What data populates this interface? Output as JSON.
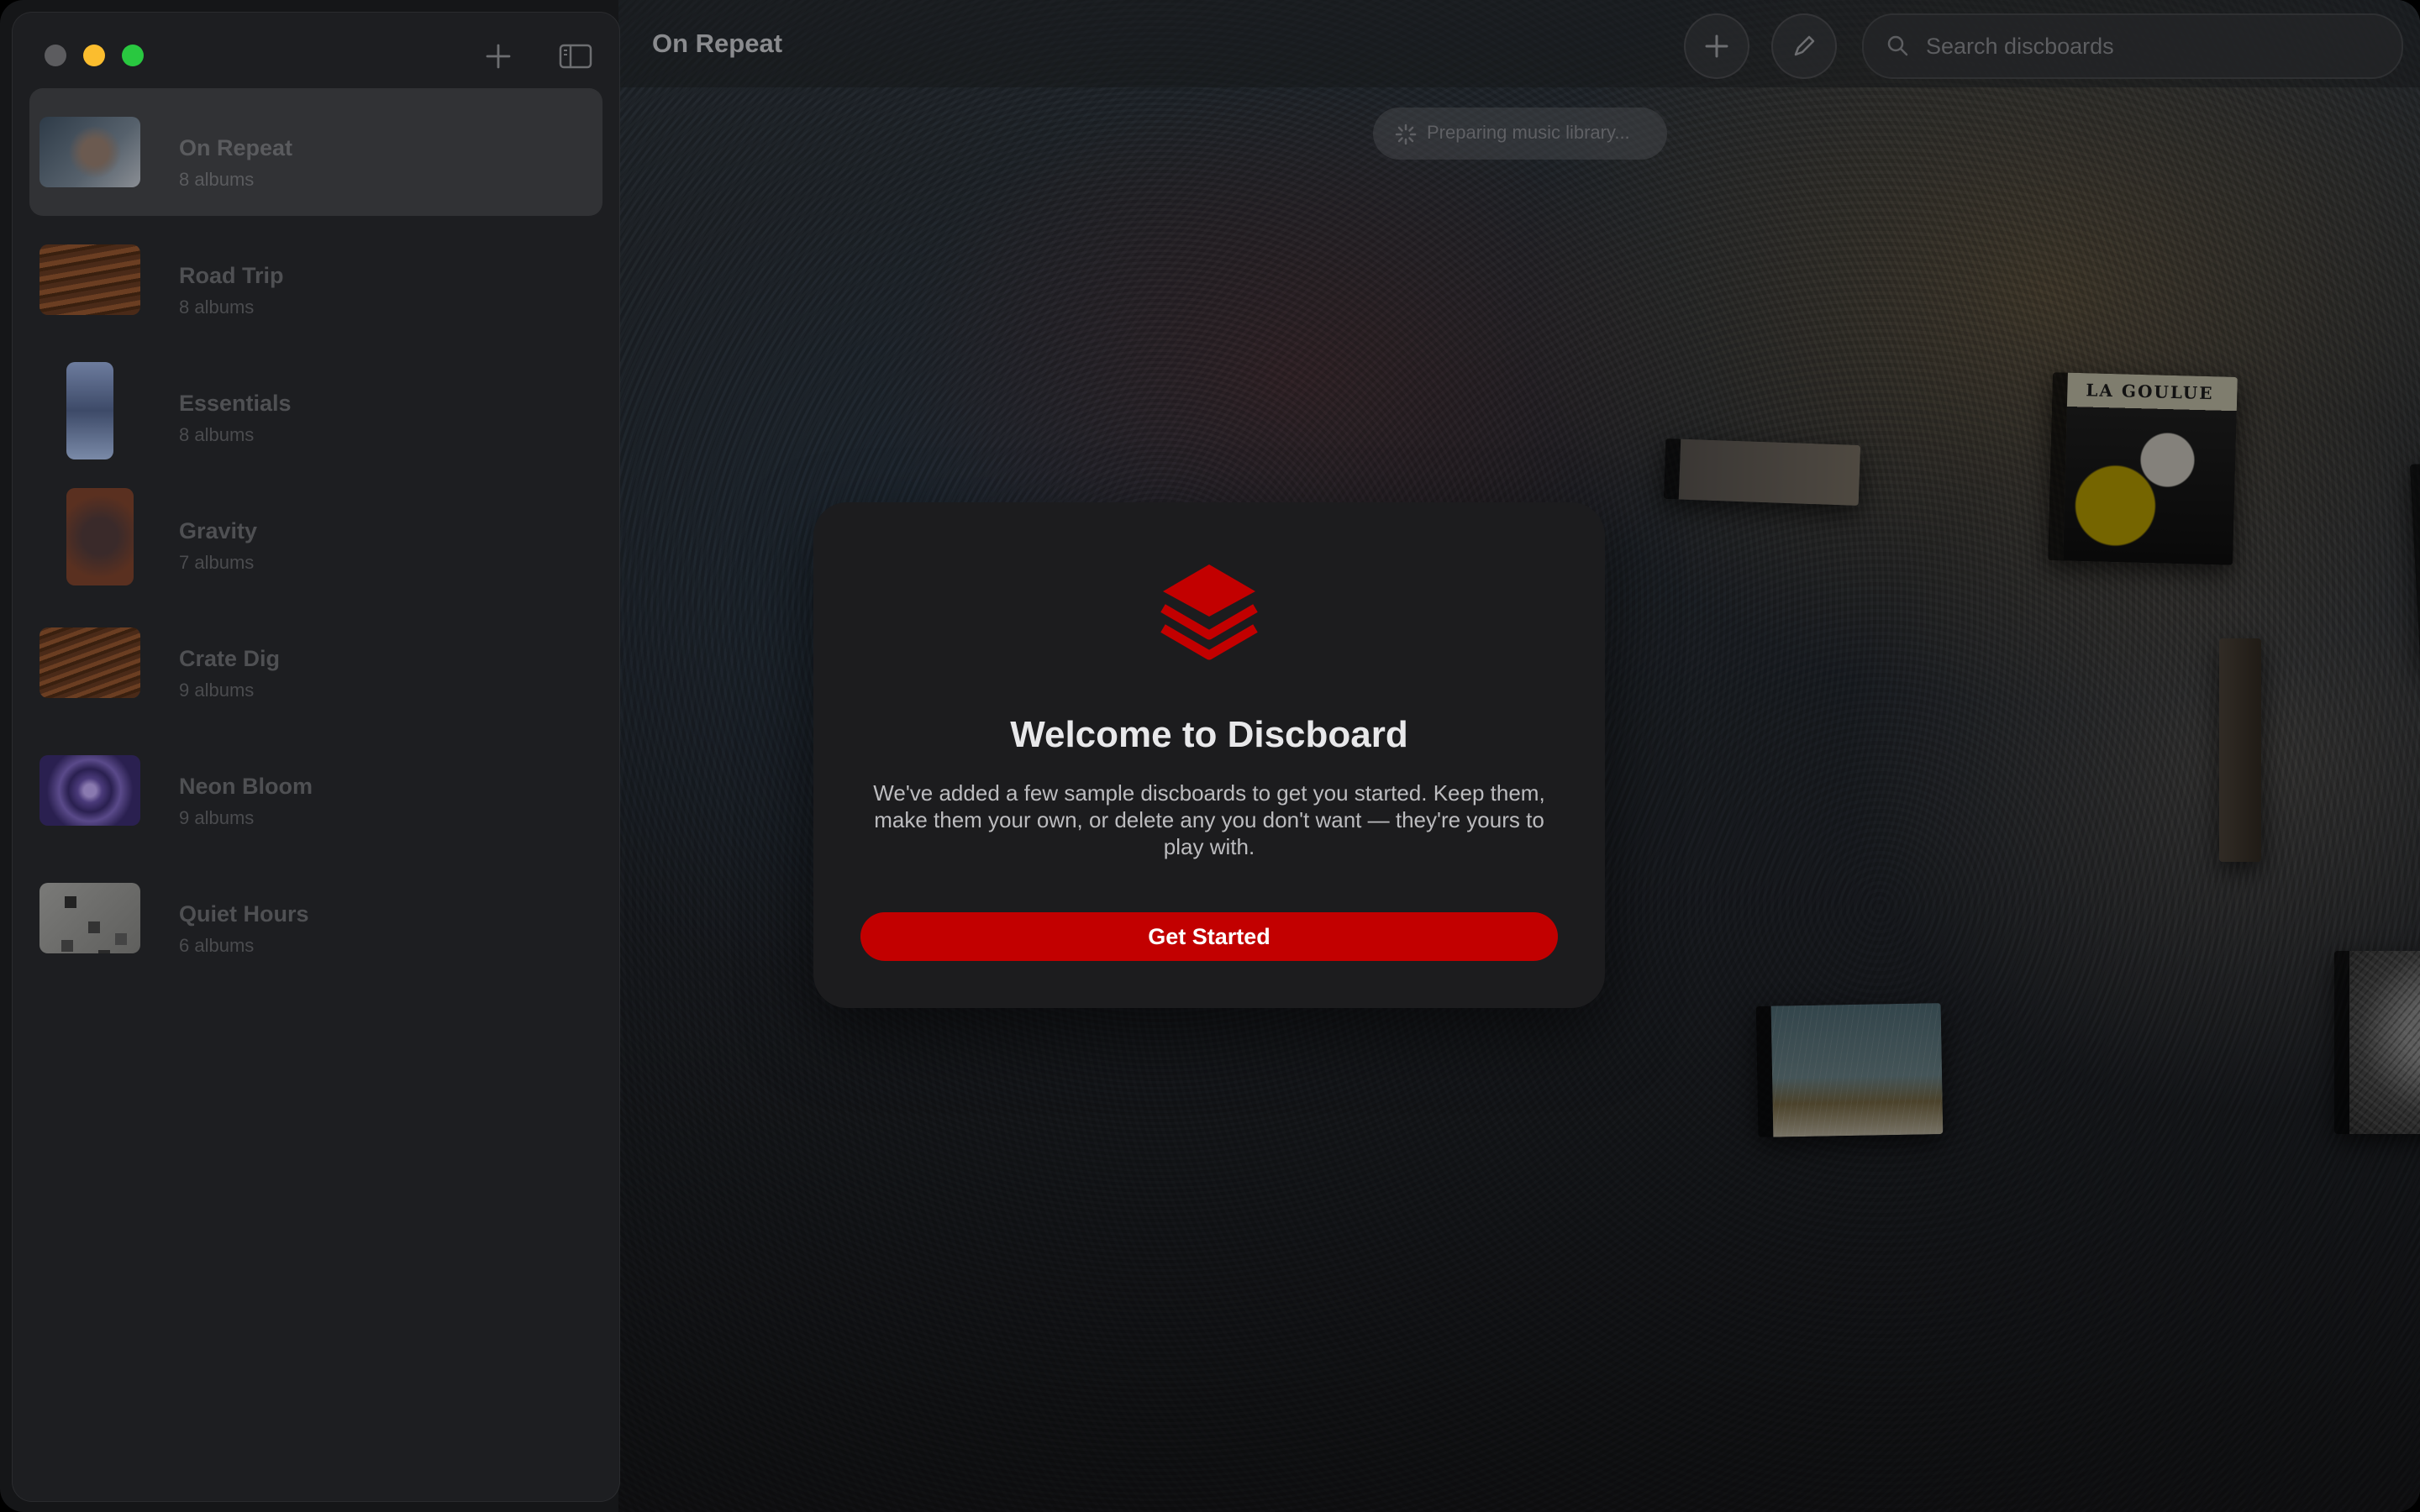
{
  "window": {
    "title": "On Repeat"
  },
  "sidebar": {
    "items": [
      {
        "title": "On Repeat",
        "subtitle": "8 albums"
      },
      {
        "title": "Road Trip",
        "subtitle": "8 albums"
      },
      {
        "title": "Essentials",
        "subtitle": "8 albums"
      },
      {
        "title": "Gravity",
        "subtitle": "7 albums"
      },
      {
        "title": "Crate Dig",
        "subtitle": "9 albums"
      },
      {
        "title": "Neon Bloom",
        "subtitle": "9 albums"
      },
      {
        "title": "Quiet Hours",
        "subtitle": "6 albums"
      }
    ]
  },
  "toolbar": {
    "search_placeholder": "Search discboards"
  },
  "status": {
    "text": "Preparing music library..."
  },
  "canvas": {
    "album_text": "LA GOULUE"
  },
  "modal": {
    "title": "Welcome to Discboard",
    "body": "We've added a few sample discboards to get you started. Keep them, make them your own, or delete any you don't want — they're yours to play with.",
    "button": "Get Started"
  },
  "colors": {
    "accent": "#c20000",
    "modal_bg": "#1c1c1e",
    "minimize": "#fbbd2e",
    "maximize": "#29c840"
  }
}
